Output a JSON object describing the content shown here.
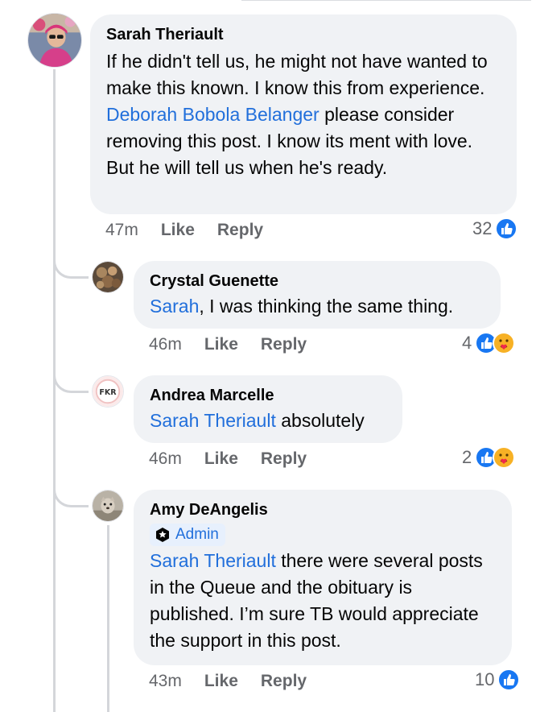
{
  "comments": [
    {
      "author": "Sarah Theriault",
      "text_parts": [
        "If he didn't tell us, he might not have wanted to make this known. I know this from experience. ",
        "Deborah Bobola Belanger",
        " please consider removing this post. I know its ment with love. But he will tell us when he's ready."
      ],
      "time": "47m",
      "like_label": "Like",
      "reply_label": "Reply",
      "reaction_count": "32",
      "reactions": [
        "like-icon"
      ]
    },
    {
      "author": "Crystal Guenette",
      "mention": "Sarah",
      "text_after": ", I was thinking the same thing.",
      "time": "46m",
      "like_label": "Like",
      "reply_label": "Reply",
      "reaction_count": "4",
      "reactions": [
        "like-icon",
        "care-icon"
      ]
    },
    {
      "author": "Andrea Marcelle",
      "avatar_text": "FKR",
      "mention": "Sarah Theriault",
      "text_after": " absolutely",
      "time": "46m",
      "like_label": "Like",
      "reply_label": "Reply",
      "reaction_count": "2",
      "reactions": [
        "like-icon",
        "care-icon"
      ]
    },
    {
      "author": "Amy DeAngelis",
      "badge": "Admin",
      "mention": "Sarah Theriault",
      "text_after": " there were several posts in the Queue and the obituary is published. I’m sure TB would appreciate the support in this post.",
      "time": "43m",
      "like_label": "Like",
      "reply_label": "Reply",
      "reaction_count": "10",
      "reactions": [
        "like-icon"
      ]
    }
  ],
  "colors": {
    "bubble": "#f0f2f5",
    "mention": "#216fdb",
    "meta": "#65676b",
    "like_blue": "#1877f2",
    "care_yellow": "#f7b125"
  }
}
